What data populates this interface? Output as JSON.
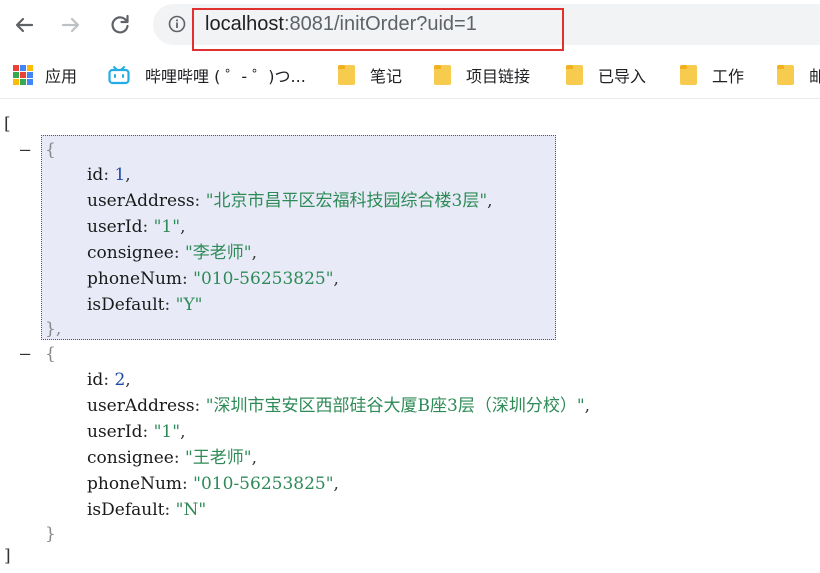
{
  "browser": {
    "url_host": "localhost",
    "url_rest": ":8081/initOrder?uid=1"
  },
  "bookmarks": [
    {
      "label": "应用",
      "icon": "apps-grid-icon"
    },
    {
      "label": "哔哩哔哩 ( ゜- ゜)つ...",
      "icon": "bilibili-icon"
    },
    {
      "label": "笔记",
      "icon": "folder-icon"
    },
    {
      "label": "项目链接",
      "icon": "folder-icon"
    },
    {
      "label": "已导入",
      "icon": "folder-icon"
    },
    {
      "label": "工作",
      "icon": "folder-icon"
    },
    {
      "label": "邮",
      "icon": "folder-icon"
    }
  ],
  "json_view": {
    "open_bracket": "[",
    "close_bracket": "]",
    "toggle": "–",
    "records": [
      {
        "open": "{",
        "close": "},",
        "fields": [
          {
            "key": "id",
            "value": "1",
            "type": "number",
            "comma": ","
          },
          {
            "key": "userAddress",
            "value": "\"北京市昌平区宏福科技园综合楼3层\"",
            "type": "string",
            "comma": ","
          },
          {
            "key": "userId",
            "value": "\"1\"",
            "type": "string",
            "comma": ","
          },
          {
            "key": "consignee",
            "value": "\"李老师\"",
            "type": "string",
            "comma": ","
          },
          {
            "key": "phoneNum",
            "value": "\"010-56253825\"",
            "type": "string",
            "comma": ","
          },
          {
            "key": "isDefault",
            "value": "\"Y\"",
            "type": "string",
            "comma": ""
          }
        ]
      },
      {
        "open": "{",
        "close": "}",
        "fields": [
          {
            "key": "id",
            "value": "2",
            "type": "number",
            "comma": ","
          },
          {
            "key": "userAddress",
            "value": "\"深圳市宝安区西部硅谷大厦B座3层（深圳分校）\"",
            "type": "string",
            "comma": ","
          },
          {
            "key": "userId",
            "value": "\"1\"",
            "type": "string",
            "comma": ","
          },
          {
            "key": "consignee",
            "value": "\"王老师\"",
            "type": "string",
            "comma": ","
          },
          {
            "key": "phoneNum",
            "value": "\"010-56253825\"",
            "type": "string",
            "comma": ","
          },
          {
            "key": "isDefault",
            "value": "\"N\"",
            "type": "string",
            "comma": ""
          }
        ]
      }
    ]
  }
}
